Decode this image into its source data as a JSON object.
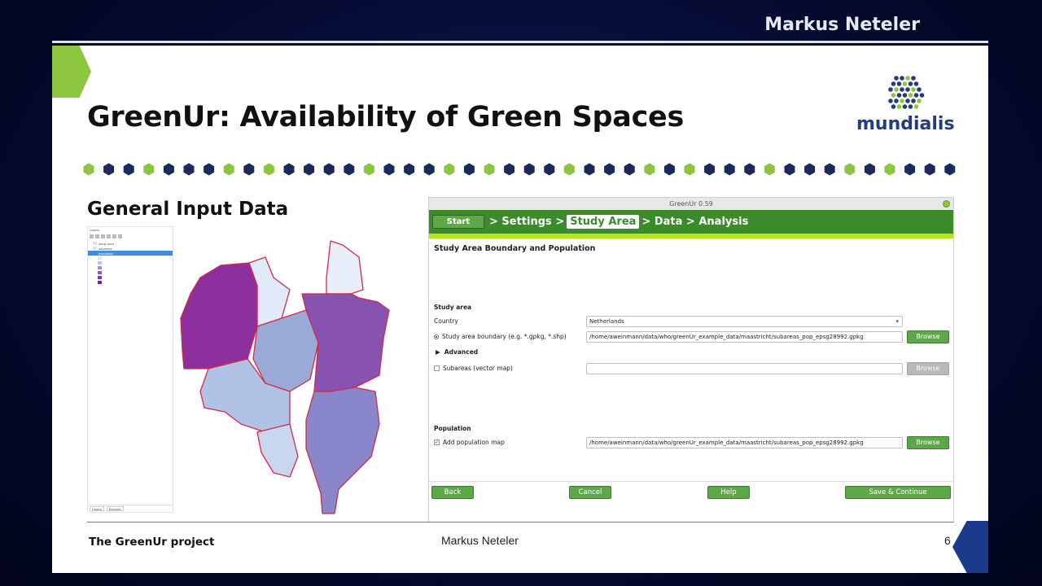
{
  "presenter": "Markus Neteler",
  "slide": {
    "title": "GreenUr: Availability of Green Spaces",
    "section_heading": "General Input Data",
    "logo_text": "mundialis",
    "footer": {
      "project": "The GreenUr project",
      "author": "Markus Neteler",
      "page": "6"
    }
  },
  "app": {
    "window_title": "GreenUr 0.59",
    "wizard": {
      "start_label": "Start",
      "steps": [
        {
          "label": "Settings",
          "active": false
        },
        {
          "label": "Study Area",
          "active": true
        },
        {
          "label": "Data",
          "active": false
        },
        {
          "label": "Analysis",
          "active": false
        }
      ]
    },
    "heading": "Study Area Boundary and Population",
    "study_area": {
      "group_label": "Study area",
      "country_label": "Country",
      "country_value": "Netherlands",
      "boundary_label": "Study area boundary (e.g. *.gpkg, *.shp)",
      "boundary_value": "/home/aweinmann/data/who/greenUr_example_data/maastricht/subareas_pop_epsg28992.gpkg",
      "browse_label": "Browse",
      "advanced_label": "Advanced",
      "subareas_label": "Subareas (vector map)",
      "subareas_value": "",
      "subareas_browse": "Browse"
    },
    "population": {
      "group_label": "Population",
      "add_label": "Add population map",
      "checked": true,
      "value": "/home/aweinmann/data/who/greenUr_example_data/maastricht/subareas_pop_epsg28992.gpkg",
      "browse_label": "Browse"
    },
    "buttons": {
      "back": "Back",
      "cancel": "Cancel",
      "help": "Help",
      "save": "Save & Continue"
    }
  },
  "qgis": {
    "panel_title": "Layers",
    "tabs": [
      "Layers",
      "Browser"
    ],
    "layers": [
      {
        "name": "study area",
        "color": "#e0e0e0",
        "selected": false
      },
      {
        "name": "subareas",
        "color": "#e0e0e0",
        "selected": false
      },
      {
        "name": "population",
        "color": "#3d8ee0",
        "selected": true
      },
      {
        "name": "",
        "color": "#dce6f5",
        "selected": false
      },
      {
        "name": "",
        "color": "#b8c4e8",
        "selected": false
      },
      {
        "name": "",
        "color": "#9b8fd0",
        "selected": false
      },
      {
        "name": "",
        "color": "#8a5ab8",
        "selected": false
      },
      {
        "name": "",
        "color": "#7a3aa8",
        "selected": false
      },
      {
        "name": "",
        "color": "#6a2a98",
        "selected": false
      }
    ]
  },
  "colors": {
    "brand_green": "#3b8a2c",
    "lime": "#b5e61d",
    "accent_green": "#8cc63f",
    "navy": "#1a2b5a"
  }
}
